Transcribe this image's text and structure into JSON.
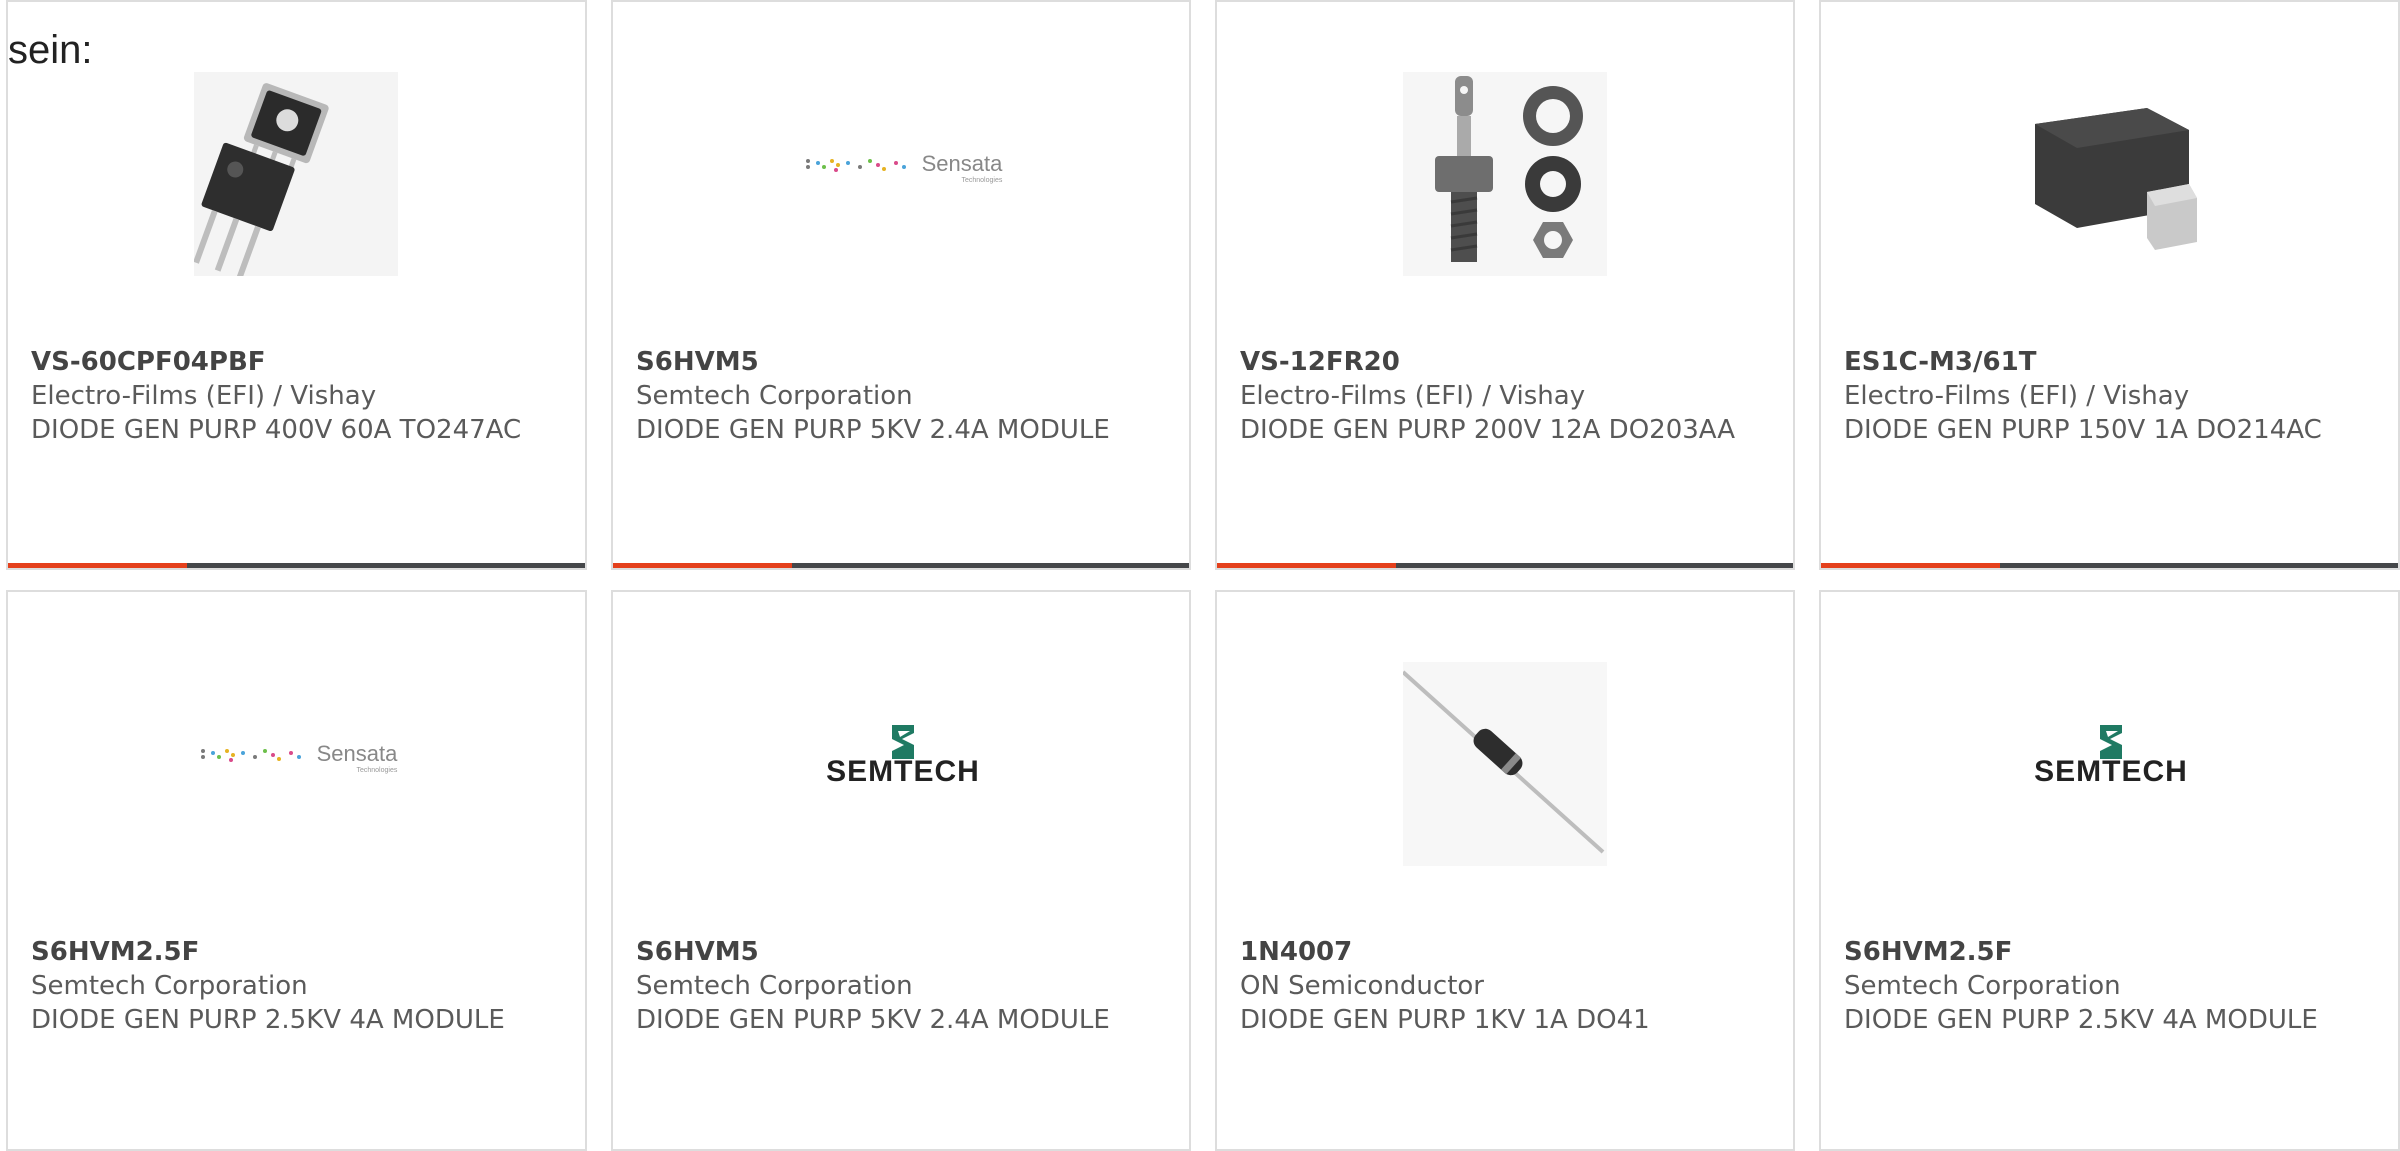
{
  "intro_text": "sein:",
  "colors": {
    "accent": "#e4401c",
    "bar_track": "#45474a",
    "border": "#dddddd"
  },
  "progress_fraction": 0.31,
  "products": [
    {
      "part_number": "VS-60CPF04PBF",
      "manufacturer": "Electro-Films (EFI) / Vishay",
      "description": "DIODE GEN PURP 400V 60A TO247AC",
      "image": "to247-package-icon"
    },
    {
      "part_number": "S6HVM5",
      "manufacturer": "Semtech Corporation",
      "description": "DIODE GEN PURP 5KV 2.4A MODULE",
      "image": "sensata-logo",
      "logo_text": "Sensata",
      "logo_subtext": "Technologies"
    },
    {
      "part_number": "VS-12FR20",
      "manufacturer": "Electro-Films (EFI) / Vishay",
      "description": "DIODE GEN PURP 200V 12A DO203AA",
      "image": "stud-diode-icon"
    },
    {
      "part_number": "ES1C-M3/61T",
      "manufacturer": "Electro-Films (EFI) / Vishay",
      "description": "DIODE GEN PURP 150V 1A DO214AC",
      "image": "smd-package-icon"
    },
    {
      "part_number": "S6HVM2.5F",
      "manufacturer": "Semtech Corporation",
      "description": "DIODE GEN PURP 2.5KV 4A MODULE",
      "image": "sensata-logo",
      "logo_text": "Sensata",
      "logo_subtext": "Technologies"
    },
    {
      "part_number": "S6HVM5",
      "manufacturer": "Semtech Corporation",
      "description": "DIODE GEN PURP 5KV 2.4A MODULE",
      "image": "semtech-logo",
      "logo_text": "SEMTECH"
    },
    {
      "part_number": "1N4007",
      "manufacturer": "ON Semiconductor",
      "description": "DIODE GEN PURP 1KV 1A DO41",
      "image": "axial-diode-icon"
    },
    {
      "part_number": "S6HVM2.5F",
      "manufacturer": "Semtech Corporation",
      "description": "DIODE GEN PURP 2.5KV 4A MODULE",
      "image": "semtech-logo",
      "logo_text": "SEMTECH"
    }
  ]
}
